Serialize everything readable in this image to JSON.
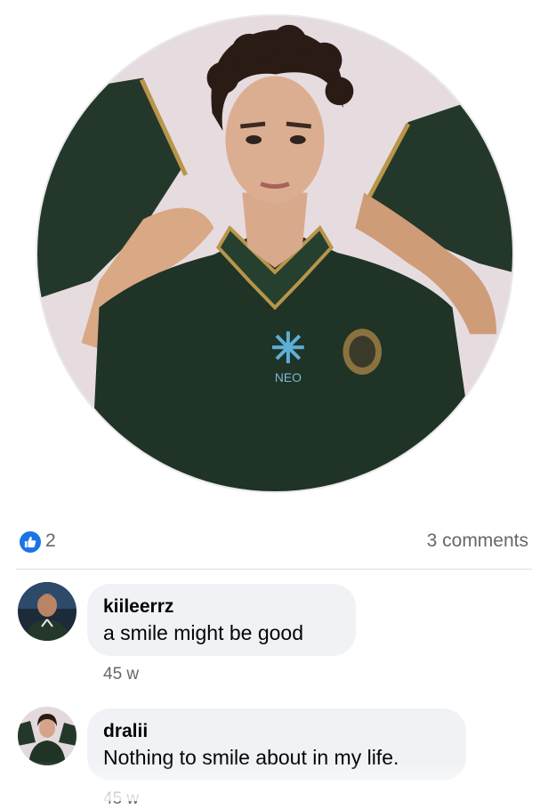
{
  "post": {
    "reactions": {
      "icon": "thumbs-up-icon",
      "count": "2",
      "color": "#1b74e4"
    },
    "comments_count": "3 comments"
  },
  "comments": [
    {
      "author": "kiileerrz",
      "text": "a smile might be good",
      "time": "45 w"
    },
    {
      "author": "dralii",
      "text": "Nothing to smile about in my life.",
      "time": "45 w"
    }
  ],
  "profile": {
    "jersey_logo": "NEO"
  },
  "colors": {
    "bubble": "#f0f2f5",
    "secondary_text": "#65676b",
    "jersey": "#1f3326",
    "trim": "#b8954a"
  }
}
